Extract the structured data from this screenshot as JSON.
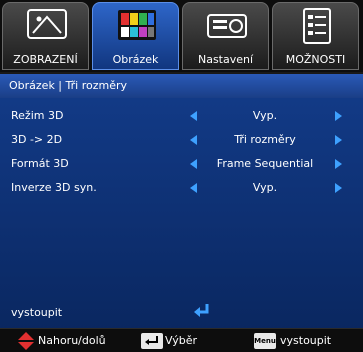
{
  "tabs": [
    {
      "label": "ZOBRAZENÍ",
      "icon": "display-settings-icon",
      "active": false
    },
    {
      "label": "Obrázek",
      "icon": "color-bars-icon",
      "active": true
    },
    {
      "label": "Nastavení",
      "icon": "projector-icon",
      "active": false
    },
    {
      "label": "MOŽNOSTI",
      "icon": "options-checklist-icon",
      "active": false
    }
  ],
  "breadcrumb": {
    "text": "Obrázek  |  Tři rozměry"
  },
  "settings": [
    {
      "label": "Režim 3D",
      "value": "Vyp."
    },
    {
      "label": "3D -> 2D",
      "value": "Tři rozměry"
    },
    {
      "label": "Formát 3D",
      "value": "Frame Sequential"
    },
    {
      "label": "Inverze 3D syn.",
      "value": "Vyp."
    }
  ],
  "exit": {
    "label": "vystoupit",
    "icon": "enter-return-icon"
  },
  "footer": {
    "nav_label": "Nahoru/dolů",
    "select_label": "Výběr",
    "menu_key": "Menu",
    "exit_label": "vystoupit"
  },
  "colors": {
    "accent": "#3ea1ff",
    "active_tab": "#2e66c9",
    "nav_red": "#e23030"
  }
}
